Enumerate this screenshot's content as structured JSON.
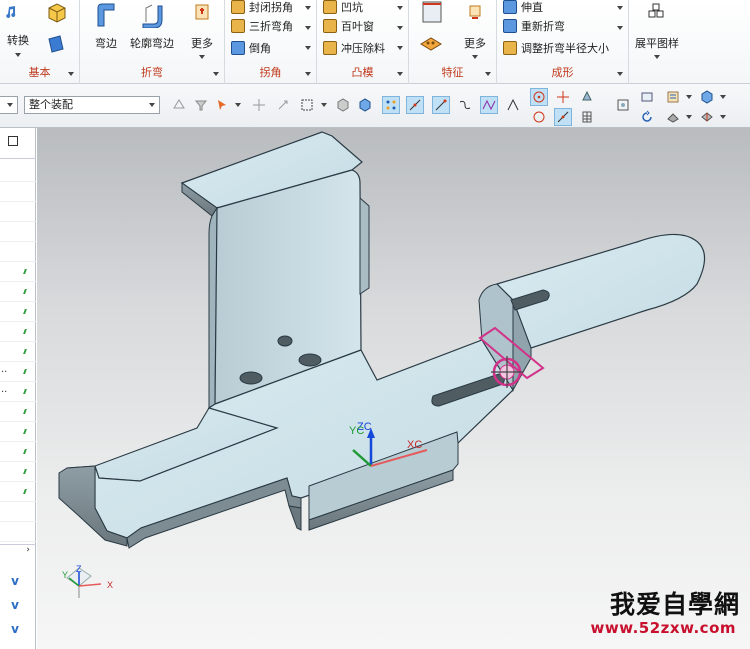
{
  "ribbon": {
    "groups": [
      {
        "label": "基本",
        "buttons": [
          "转换"
        ]
      },
      {
        "label": "折弯",
        "buttons": [
          "弯边",
          "轮廓弯边",
          "更多"
        ]
      },
      {
        "label": "拐角",
        "items": [
          "封闭拐角",
          "三折弯角",
          "倒角"
        ]
      },
      {
        "label": "凸模",
        "items": [
          "凹坑",
          "百叶窗",
          "冲压除料"
        ]
      },
      {
        "label": "特征",
        "buttons": [
          "更多"
        ]
      },
      {
        "label": "成形",
        "items": [
          "伸直",
          "重新折弯",
          "调整折弯半径大小"
        ]
      },
      {
        "label": "",
        "buttons": [
          "展平图样"
        ]
      }
    ]
  },
  "toolbar": {
    "filter_select": "",
    "assembly_select": "整个装配"
  },
  "viewport": {
    "labels": {
      "zc": "ZC",
      "yc": "YC",
      "xc": "XC"
    },
    "triad": {
      "z": "Z",
      "y": "Y",
      "x": "X"
    },
    "watermark": {
      "text": "我爱自學網",
      "url": "www.52zxw.com"
    }
  },
  "left_panel": {
    "row_marks": [
      "..",
      ".."
    ],
    "expand_label": "v"
  },
  "colors": {
    "accent_label": "#c0391b",
    "part_face": "#cfe3ea",
    "part_edge": "#2a3a44",
    "part_side": "#7d8b92",
    "highlight": "#d2328a"
  }
}
